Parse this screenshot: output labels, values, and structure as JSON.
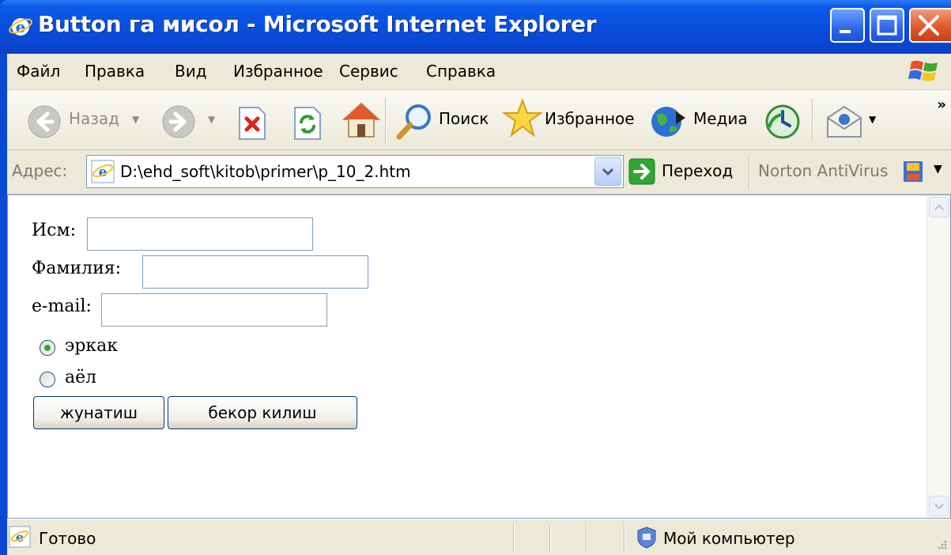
{
  "window": {
    "title": "Button га мисол - Microsoft Internet Explorer"
  },
  "menu": {
    "items": [
      "Файл",
      "Правка",
      "Вид",
      "Избранное",
      "Сервис",
      "Справка"
    ]
  },
  "toolbar": {
    "back_label": "Назад",
    "search_label": "Поиск",
    "favorites_label": "Избранное",
    "media_label": "Медиа",
    "overflow": "»"
  },
  "address": {
    "label": "Адрес:",
    "url": "D:\\ehd_soft\\kitob\\primer\\p_10_2.htm",
    "go_label": "Переход",
    "norton_label": "Norton AntiVirus"
  },
  "form": {
    "name_label": "Исм:",
    "surname_label": "Фамилия:",
    "email_label": "e-mail:",
    "name_value": "",
    "surname_value": "",
    "email_value": "",
    "radio_male_label": "эркак",
    "radio_female_label": "аёл",
    "radio_selected": "эркак",
    "submit_label": "жунатиш",
    "reset_label": "бекор килиш"
  },
  "status": {
    "text": "Готово",
    "zone": "Мой компьютер"
  }
}
